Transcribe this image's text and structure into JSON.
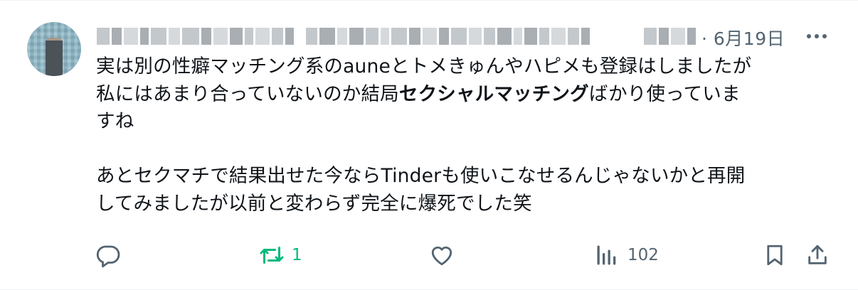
{
  "tweet": {
    "date": "6月19日",
    "body": {
      "line1": "実は別の性癖マッチング系のauneとトメきゅんやハピメも登録はしましたが",
      "line2_pre": "私にはあまり合っていないのか結局",
      "line2_bold": "セクシャルマッチング",
      "line2_post": "ばかり使っていま",
      "line3": "すね",
      "line4": "あとセクマチで結果出せた今ならTinderも使いこなせるんじゃないかと再開",
      "line5": "してみましたが以前と変わらず完全に爆死でした笑"
    },
    "actions": {
      "reply_icon": "reply-icon",
      "retweet_icon": "retweet-icon",
      "retweet_count": "1",
      "like_icon": "heart-icon",
      "views_icon": "views-chart-icon",
      "views_count": "102",
      "bookmark_icon": "bookmark-icon",
      "share_icon": "share-icon"
    },
    "colors": {
      "text": "#0f1419",
      "secondary": "#536471",
      "retweet_active": "#00ba7c"
    }
  }
}
